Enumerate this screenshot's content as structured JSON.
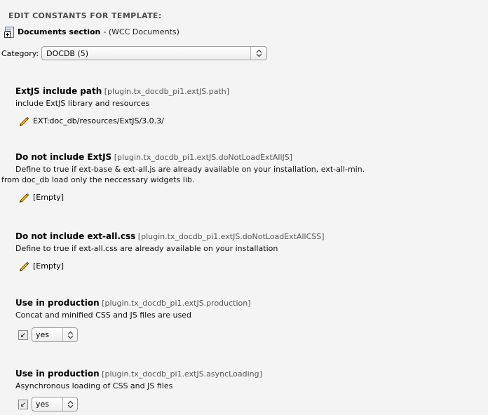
{
  "header": {
    "title": "EDIT CONSTANTS FOR TEMPLATE:"
  },
  "section": {
    "icon": "document-page-icon",
    "title": "Documents section",
    "suffix": " - (WCC Documents)"
  },
  "category": {
    "label": "Category:",
    "selected": "DOCDB (5)"
  },
  "constants": [
    {
      "title": "ExtJS include path",
      "key": "[plugin.tx_docdb_pi1.extJS.path]",
      "description": [
        "include ExtJS library and resources"
      ],
      "value_type": "text",
      "value": "EXT:doc_db/resources/ExtJS/3.0.3/"
    },
    {
      "title": "Do not include ExtJS",
      "key": "[plugin.tx_docdb_pi1.extJS.doNotLoadExtAllJS]",
      "description": [
        "Define to true if ext-base & ext-all.js are already available on your installation, ext-all-min.",
        "from doc_db load only the neccessary widgets lib."
      ],
      "value_type": "text",
      "value": "[Empty]"
    },
    {
      "title": "Do not include ext-all.css",
      "key": "[plugin.tx_docdb_pi1.extJS.doNotLoadExtAllCSS]",
      "description": [
        "Define to true if ext-all.css are already available on your installation"
      ],
      "value_type": "text",
      "value": "[Empty]"
    },
    {
      "title": "Use in production",
      "key": "[plugin.tx_docdb_pi1.extJS.production]",
      "description": [
        "Concat and minified CSS and JS files are used"
      ],
      "value_type": "select",
      "value": "yes"
    },
    {
      "title": "Use in production",
      "key": "[plugin.tx_docdb_pi1.extJS.asyncLoading]",
      "description": [
        "Asynchronous loading of CSS and JS files"
      ],
      "value_type": "select",
      "value": "yes"
    }
  ],
  "icons": {
    "pencil": "pencil-icon",
    "revert": "revert-arrow-icon",
    "select_arrows": "up-down-arrows-icon"
  },
  "colors": {
    "background": "#f4f4f4",
    "pencil": "#f0b400"
  }
}
